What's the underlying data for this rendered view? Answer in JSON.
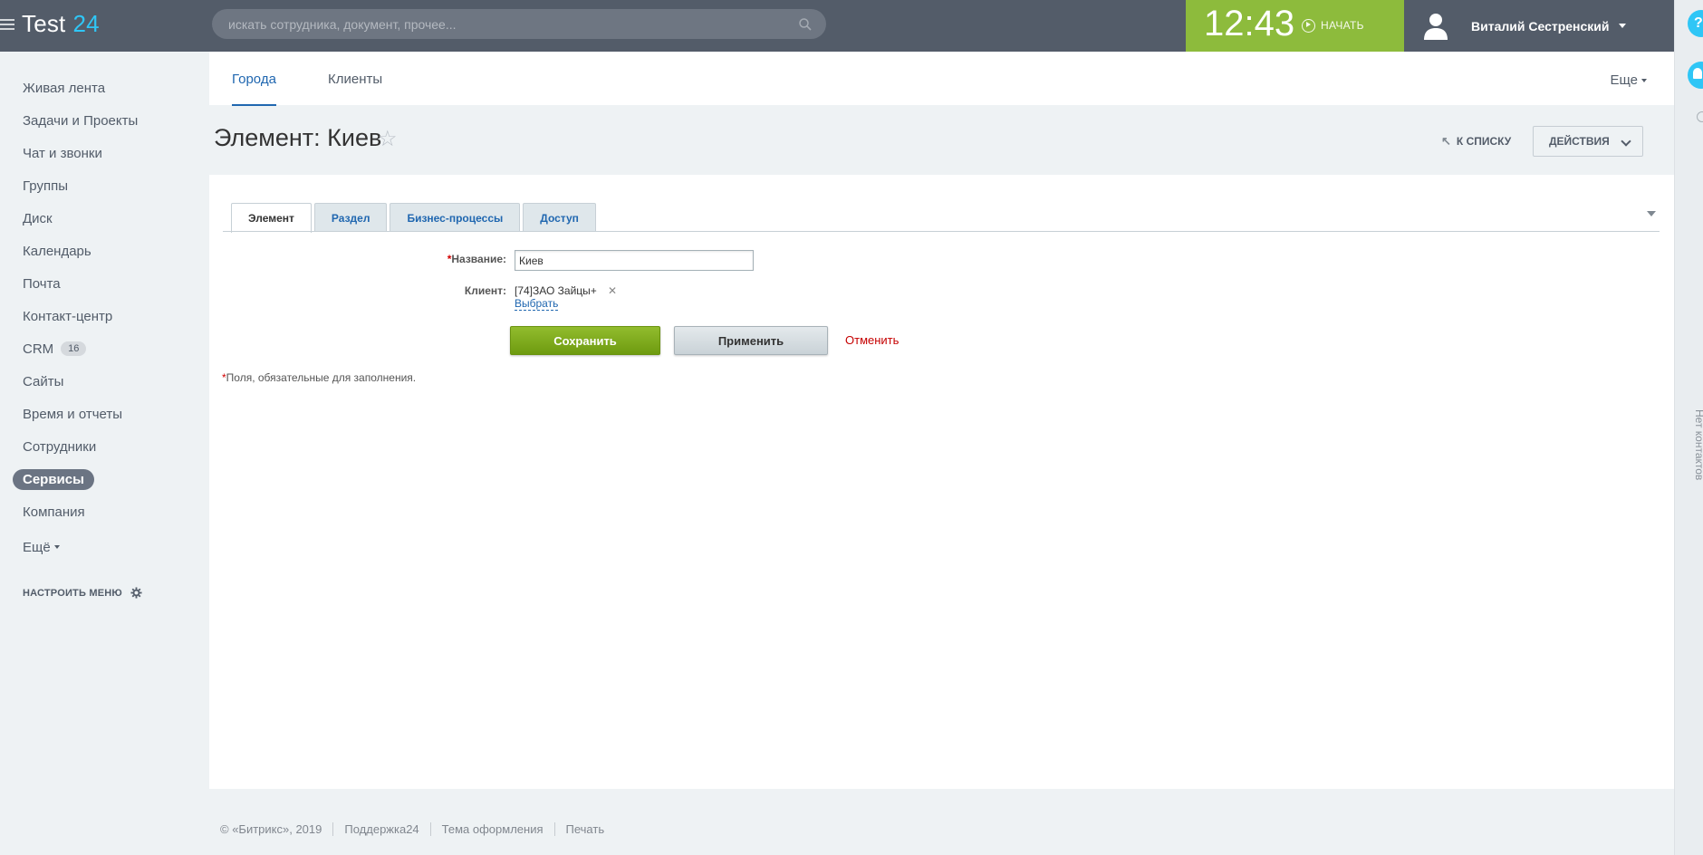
{
  "header": {
    "logo_text": "Test",
    "logo_number": "24",
    "search_placeholder": "искать сотрудника, документ, прочее...",
    "time": "12:43",
    "start_label": "НАЧАТЬ",
    "user_name": "Виталий Сестренский"
  },
  "sidebar": {
    "items": [
      {
        "label": "Живая лента"
      },
      {
        "label": "Задачи и Проекты"
      },
      {
        "label": "Чат и звонки"
      },
      {
        "label": "Группы"
      },
      {
        "label": "Диск"
      },
      {
        "label": "Календарь"
      },
      {
        "label": "Почта"
      },
      {
        "label": "Контакт-центр"
      },
      {
        "label": "CRM",
        "counter": "16"
      },
      {
        "label": "Сайты"
      },
      {
        "label": "Время и отчеты"
      },
      {
        "label": "Сотрудники"
      },
      {
        "label": "Сервисы",
        "active": true
      },
      {
        "label": "Компания"
      },
      {
        "label": "Ещё"
      }
    ],
    "configure_label": "НАСТРОИТЬ МЕНЮ"
  },
  "top_tabs": {
    "tab1": "Города",
    "tab2": "Клиенты",
    "more": "Еще"
  },
  "page": {
    "title": "Элемент: Киев",
    "to_list": "К СПИСКУ",
    "actions": "ДЕЙСТВИЯ"
  },
  "form": {
    "tabs": [
      "Элемент",
      "Раздел",
      "Бизнес-процессы",
      "Доступ"
    ],
    "name_label": "Название:",
    "name_value": "Киев",
    "client_label": "Клиент:",
    "client_value": "[74]ЗАО Зайцы+",
    "choose_label": "Выбрать",
    "save_label": "Сохранить",
    "apply_label": "Применить",
    "cancel_label": "Отменить",
    "required_note": "Поля, обязательные для заполнения."
  },
  "right_panel": {
    "vertical_text": "Нет контактов"
  },
  "footer": {
    "copyright": "© «Битрикс», 2019",
    "support": "Поддержка24",
    "theme": "Тема оформления",
    "print": "Печать"
  },
  "colors": {
    "header_bg": "#535c69",
    "timer_bg": "#8dbb3c",
    "accent_blue": "#2067b0",
    "logo_accent": "#2fc6f6"
  }
}
